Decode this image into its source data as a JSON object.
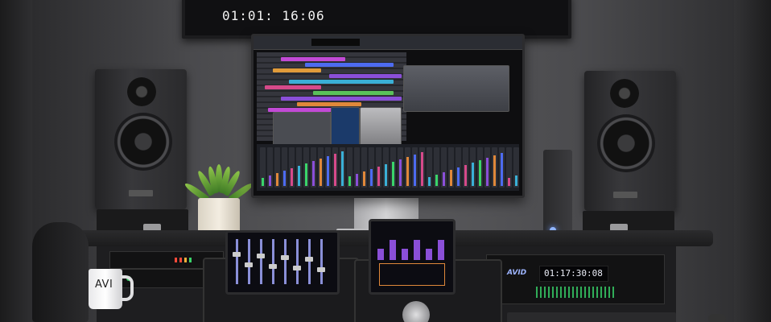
{
  "tv": {
    "timecode": "01:01: 16:06"
  },
  "rack": {
    "timecode": "01:17:30:08",
    "brand": "AVID"
  },
  "mug": {
    "logo": "AVI"
  },
  "icons": {
    "speaker": "studio-monitor-speaker-icon",
    "plant": "potted-plant-icon",
    "tower": "audio-interface-tower-icon"
  },
  "colors": {
    "wall": "#5a5a5d",
    "desk": "#1c1c1d",
    "accent_purple": "#8a4fd8",
    "accent_orange": "#e0883a",
    "meter_green": "#38d46a",
    "tower_led": "#8fb4ff"
  }
}
